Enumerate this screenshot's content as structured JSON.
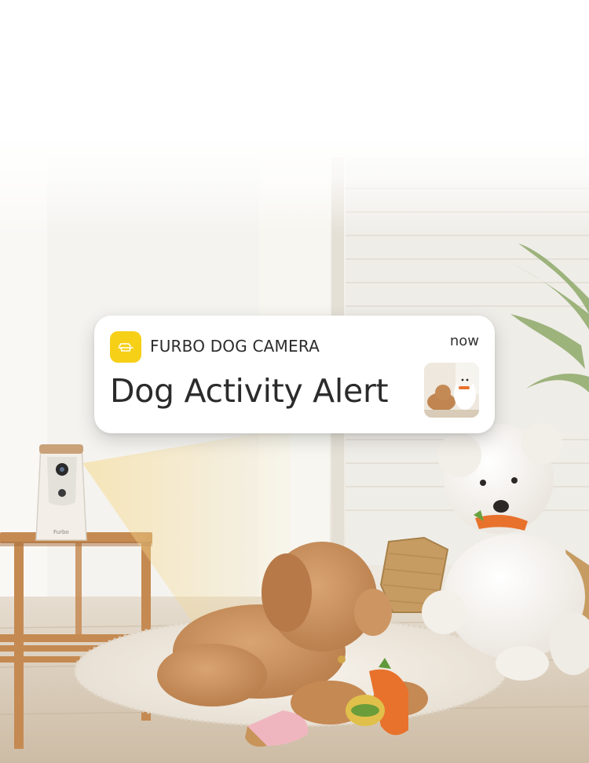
{
  "notification": {
    "app_icon": "furbo-camera-icon",
    "app_name": "FURBO DOG CAMERA",
    "time": "now",
    "title": "Dog Activity Alert",
    "thumbnail": "dog-activity-thumbnail"
  },
  "scene": {
    "description_icon": "living-room-photo",
    "device_brand": "Furbo",
    "accent_color": "#f6cf17"
  }
}
